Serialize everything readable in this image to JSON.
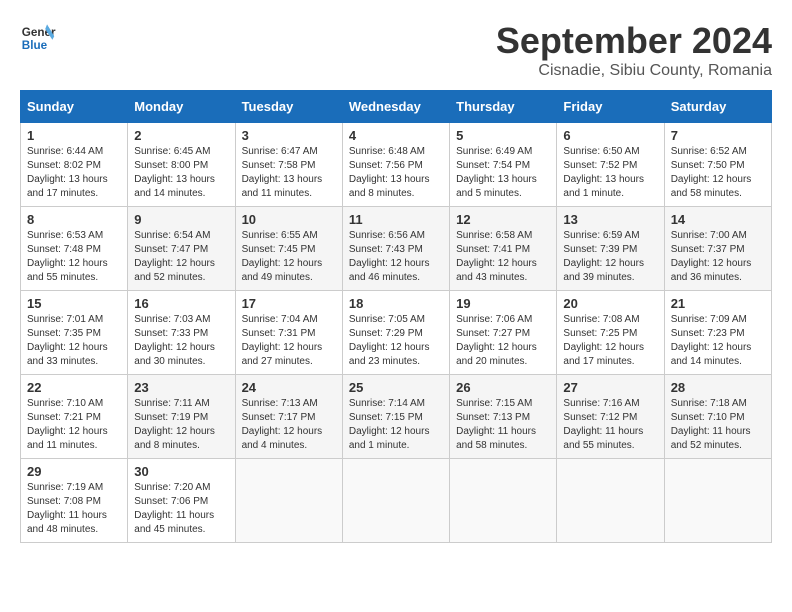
{
  "header": {
    "logo_line1": "General",
    "logo_line2": "Blue",
    "month": "September 2024",
    "location": "Cisnadie, Sibiu County, Romania"
  },
  "weekdays": [
    "Sunday",
    "Monday",
    "Tuesday",
    "Wednesday",
    "Thursday",
    "Friday",
    "Saturday"
  ],
  "weeks": [
    [
      {
        "day": "1",
        "info": "Sunrise: 6:44 AM\nSunset: 8:02 PM\nDaylight: 13 hours\nand 17 minutes."
      },
      {
        "day": "2",
        "info": "Sunrise: 6:45 AM\nSunset: 8:00 PM\nDaylight: 13 hours\nand 14 minutes."
      },
      {
        "day": "3",
        "info": "Sunrise: 6:47 AM\nSunset: 7:58 PM\nDaylight: 13 hours\nand 11 minutes."
      },
      {
        "day": "4",
        "info": "Sunrise: 6:48 AM\nSunset: 7:56 PM\nDaylight: 13 hours\nand 8 minutes."
      },
      {
        "day": "5",
        "info": "Sunrise: 6:49 AM\nSunset: 7:54 PM\nDaylight: 13 hours\nand 5 minutes."
      },
      {
        "day": "6",
        "info": "Sunrise: 6:50 AM\nSunset: 7:52 PM\nDaylight: 13 hours\nand 1 minute."
      },
      {
        "day": "7",
        "info": "Sunrise: 6:52 AM\nSunset: 7:50 PM\nDaylight: 12 hours\nand 58 minutes."
      }
    ],
    [
      {
        "day": "8",
        "info": "Sunrise: 6:53 AM\nSunset: 7:48 PM\nDaylight: 12 hours\nand 55 minutes."
      },
      {
        "day": "9",
        "info": "Sunrise: 6:54 AM\nSunset: 7:47 PM\nDaylight: 12 hours\nand 52 minutes."
      },
      {
        "day": "10",
        "info": "Sunrise: 6:55 AM\nSunset: 7:45 PM\nDaylight: 12 hours\nand 49 minutes."
      },
      {
        "day": "11",
        "info": "Sunrise: 6:56 AM\nSunset: 7:43 PM\nDaylight: 12 hours\nand 46 minutes."
      },
      {
        "day": "12",
        "info": "Sunrise: 6:58 AM\nSunset: 7:41 PM\nDaylight: 12 hours\nand 43 minutes."
      },
      {
        "day": "13",
        "info": "Sunrise: 6:59 AM\nSunset: 7:39 PM\nDaylight: 12 hours\nand 39 minutes."
      },
      {
        "day": "14",
        "info": "Sunrise: 7:00 AM\nSunset: 7:37 PM\nDaylight: 12 hours\nand 36 minutes."
      }
    ],
    [
      {
        "day": "15",
        "info": "Sunrise: 7:01 AM\nSunset: 7:35 PM\nDaylight: 12 hours\nand 33 minutes."
      },
      {
        "day": "16",
        "info": "Sunrise: 7:03 AM\nSunset: 7:33 PM\nDaylight: 12 hours\nand 30 minutes."
      },
      {
        "day": "17",
        "info": "Sunrise: 7:04 AM\nSunset: 7:31 PM\nDaylight: 12 hours\nand 27 minutes."
      },
      {
        "day": "18",
        "info": "Sunrise: 7:05 AM\nSunset: 7:29 PM\nDaylight: 12 hours\nand 23 minutes."
      },
      {
        "day": "19",
        "info": "Sunrise: 7:06 AM\nSunset: 7:27 PM\nDaylight: 12 hours\nand 20 minutes."
      },
      {
        "day": "20",
        "info": "Sunrise: 7:08 AM\nSunset: 7:25 PM\nDaylight: 12 hours\nand 17 minutes."
      },
      {
        "day": "21",
        "info": "Sunrise: 7:09 AM\nSunset: 7:23 PM\nDaylight: 12 hours\nand 14 minutes."
      }
    ],
    [
      {
        "day": "22",
        "info": "Sunrise: 7:10 AM\nSunset: 7:21 PM\nDaylight: 12 hours\nand 11 minutes."
      },
      {
        "day": "23",
        "info": "Sunrise: 7:11 AM\nSunset: 7:19 PM\nDaylight: 12 hours\nand 8 minutes."
      },
      {
        "day": "24",
        "info": "Sunrise: 7:13 AM\nSunset: 7:17 PM\nDaylight: 12 hours\nand 4 minutes."
      },
      {
        "day": "25",
        "info": "Sunrise: 7:14 AM\nSunset: 7:15 PM\nDaylight: 12 hours\nand 1 minute."
      },
      {
        "day": "26",
        "info": "Sunrise: 7:15 AM\nSunset: 7:13 PM\nDaylight: 11 hours\nand 58 minutes."
      },
      {
        "day": "27",
        "info": "Sunrise: 7:16 AM\nSunset: 7:12 PM\nDaylight: 11 hours\nand 55 minutes."
      },
      {
        "day": "28",
        "info": "Sunrise: 7:18 AM\nSunset: 7:10 PM\nDaylight: 11 hours\nand 52 minutes."
      }
    ],
    [
      {
        "day": "29",
        "info": "Sunrise: 7:19 AM\nSunset: 7:08 PM\nDaylight: 11 hours\nand 48 minutes."
      },
      {
        "day": "30",
        "info": "Sunrise: 7:20 AM\nSunset: 7:06 PM\nDaylight: 11 hours\nand 45 minutes."
      },
      {
        "day": "",
        "info": ""
      },
      {
        "day": "",
        "info": ""
      },
      {
        "day": "",
        "info": ""
      },
      {
        "day": "",
        "info": ""
      },
      {
        "day": "",
        "info": ""
      }
    ]
  ]
}
